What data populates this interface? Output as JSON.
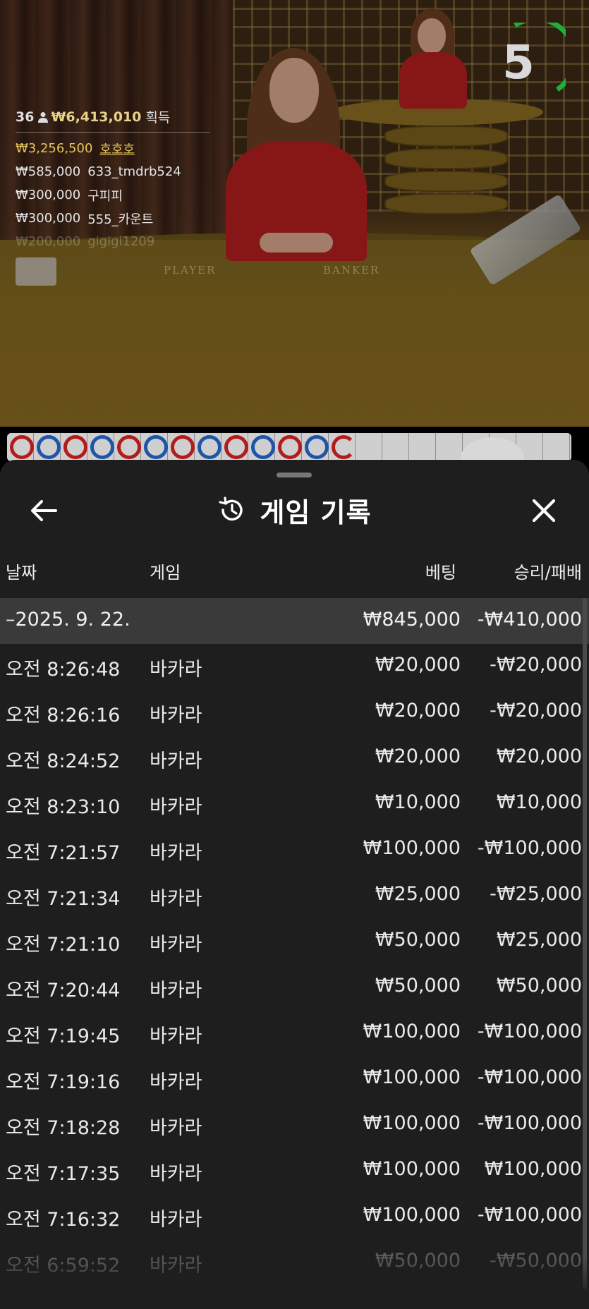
{
  "stream": {
    "countdown": "5",
    "table_labels": {
      "player": "PLAYER",
      "banker": "BANKER"
    }
  },
  "leaderboard": {
    "player_count": "36",
    "total_win": "₩6,413,010",
    "total_label": "획득",
    "winners": [
      {
        "amount": "₩3,256,500",
        "name": "호호호"
      },
      {
        "amount": "₩585,000",
        "name": "633_tmdrb524"
      },
      {
        "amount": "₩300,000",
        "name": "구피피"
      },
      {
        "amount": "₩300,000",
        "name": "555_카운트"
      },
      {
        "amount": "₩200,000",
        "name": "gigigi1209"
      }
    ]
  },
  "bead_road": [
    "red",
    "blue",
    "red",
    "blue",
    "red",
    "blue",
    "red",
    "blue",
    "red",
    "blue",
    "red",
    "blue",
    "red"
  ],
  "history": {
    "title": "게임 기록",
    "columns": {
      "date": "날짜",
      "game": "게임",
      "bet": "베팅",
      "result": "승리/패배"
    },
    "summary": {
      "date": "–2025. 9. 22.",
      "bet": "₩845,000",
      "result": "-₩410,000"
    },
    "rows": [
      {
        "time": "오전 8:26:48",
        "game": "바카라",
        "bet": "₩20,000",
        "result": "-₩20,000"
      },
      {
        "time": "오전 8:26:16",
        "game": "바카라",
        "bet": "₩20,000",
        "result": "-₩20,000"
      },
      {
        "time": "오전 8:24:52",
        "game": "바카라",
        "bet": "₩20,000",
        "result": "₩20,000"
      },
      {
        "time": "오전 8:23:10",
        "game": "바카라",
        "bet": "₩10,000",
        "result": "₩10,000"
      },
      {
        "time": "오전 7:21:57",
        "game": "바카라",
        "bet": "₩100,000",
        "result": "-₩100,000"
      },
      {
        "time": "오전 7:21:34",
        "game": "바카라",
        "bet": "₩25,000",
        "result": "-₩25,000"
      },
      {
        "time": "오전 7:21:10",
        "game": "바카라",
        "bet": "₩50,000",
        "result": "₩25,000"
      },
      {
        "time": "오전 7:20:44",
        "game": "바카라",
        "bet": "₩50,000",
        "result": "₩50,000"
      },
      {
        "time": "오전 7:19:45",
        "game": "바카라",
        "bet": "₩100,000",
        "result": "-₩100,000"
      },
      {
        "time": "오전 7:19:16",
        "game": "바카라",
        "bet": "₩100,000",
        "result": "-₩100,000"
      },
      {
        "time": "오전 7:18:28",
        "game": "바카라",
        "bet": "₩100,000",
        "result": "-₩100,000"
      },
      {
        "time": "오전 7:17:35",
        "game": "바카라",
        "bet": "₩100,000",
        "result": "₩100,000"
      },
      {
        "time": "오전 7:16:32",
        "game": "바카라",
        "bet": "₩100,000",
        "result": "-₩100,000"
      },
      {
        "time": "오전 6:59:52",
        "game": "바카라",
        "bet": "₩50,000",
        "result": "-₩50,000"
      }
    ]
  },
  "icons": {
    "back": "arrow-left-icon",
    "close": "close-icon",
    "history": "history-icon",
    "person": "person-icon"
  },
  "colors": {
    "sheet_bg": "#1e1e1e",
    "summary_bg": "#3a3a3a",
    "countdown_ring": "#1fae3a",
    "bead_red": "#b11c1c",
    "bead_blue": "#1f55a8",
    "top_winner": "#e4c45a"
  }
}
